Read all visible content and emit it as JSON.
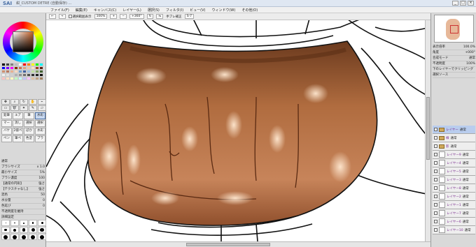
{
  "titlebar": {
    "app_name": "SAI",
    "file_name": "紺_CUSTOM DETRE (自動保存) ...",
    "minimize": "_",
    "maximize": "□",
    "close": "×"
  },
  "menubar": {
    "items": [
      "ファイル(F)",
      "編集(E)",
      "キャンバス(C)",
      "レイヤー(L)",
      "選択(S)",
      "フィルタ(I)",
      "ビュー(V)",
      "ウィンドウ(W)",
      "その他(O)"
    ]
  },
  "toolbar": {
    "selection_toggle": "選択範囲表示",
    "zoom": "100%",
    "angle": "+360°",
    "stabilizer_label": "手ブレ補正",
    "stabilizer_value": "S-7"
  },
  "left_panel": {
    "swatch_colors": [
      "#000000",
      "#404040",
      "#808080",
      "#c0c0c0",
      "#ffffff",
      "#ff0000",
      "#ff8000",
      "#ffff00",
      "#00ff00",
      "#00ffff",
      "#0000ff",
      "#8000ff",
      "#ff00ff",
      "#803000",
      "#c87050",
      "#e0a080",
      "#f0c8a8",
      "#ffe0c8",
      "#a04020",
      "#602010",
      "#d09070",
      "#b87860",
      "#e8b090",
      "#f8d8c0",
      "#70a0d0",
      "#4060a0",
      "#a0c0e0",
      "#c0e0a0",
      "#80a060",
      "#406030",
      "#f0f0f0",
      "#e0e0e0",
      "#d0d0d0",
      "#b0b0b0",
      "#909090",
      "#707070",
      "#505050",
      "#303030",
      "#202020",
      "#101010",
      "#ffc0c0",
      "#ffe0c0",
      "#ffffc0",
      "#c0ffc0",
      "#c0ffff",
      "#c0c0ff",
      "#ffc0ff",
      "#e0c0a0",
      "#c0a080",
      "#a08060"
    ],
    "tool_icons": [
      "move-icon",
      "zoom-icon",
      "rotate-icon",
      "hand-icon",
      "eyedropper-icon",
      "select-icon",
      "lasso-icon",
      "wand-icon",
      "pen-icon",
      "eraser-icon"
    ],
    "brushes": [
      "鉛筆",
      "エアブラシ",
      "筆",
      "水彩筆",
      "マーカー",
      "消しゴム",
      "選択ペン",
      "選択消し",
      "バケツ",
      "2値ペン",
      "ぼかし",
      "水彩",
      "ペン",
      "筆ペン",
      "色塗り",
      "ブラシ"
    ],
    "selected_brush_index": 3,
    "props": [
      {
        "label": "通常",
        "value": ""
      },
      {
        "label": "ブラシサイズ",
        "value": "x 1.0"
      },
      {
        "label": "最小サイズ",
        "value": "5%"
      },
      {
        "label": "ブラシ濃度",
        "value": "100"
      },
      {
        "label": "【通常の円形】",
        "value": "強さ"
      },
      {
        "label": "【テクスチャなし】",
        "value": "強さ"
      },
      {
        "label": "混色",
        "value": "50"
      },
      {
        "label": "水分量",
        "value": "0"
      },
      {
        "label": "色延び",
        "value": "0"
      },
      {
        "label": "不透明度を維持",
        "value": ""
      },
      {
        "label": "詳細設定",
        "value": ""
      }
    ],
    "size_labels": [
      "0.7",
      "0.8",
      "1",
      "1.5",
      "2",
      "2.3",
      "2.6",
      "3",
      "3.5",
      "4",
      "5",
      "6",
      "7",
      "8",
      "9"
    ]
  },
  "right_panel": {
    "props": [
      {
        "label": "表示倍率",
        "value": "100.0%"
      },
      {
        "label": "角度",
        "value": "+000°"
      },
      {
        "label": "合成モード",
        "value": "通常"
      },
      {
        "label": "不透明度",
        "value": "100%"
      },
      {
        "label": "下のレイヤーでクリッピング",
        "value": ""
      },
      {
        "label": "選択ソース",
        "value": ""
      }
    ],
    "layers": [
      {
        "name": "レイヤー",
        "mode": "通常",
        "type": "folder"
      },
      {
        "name": "線",
        "mode": "通常",
        "type": "folder"
      },
      {
        "name": "影",
        "mode": "通常",
        "type": "folder"
      },
      {
        "name": "レイヤー9",
        "mode": "通常",
        "type": "layer"
      },
      {
        "name": "レイヤー4",
        "mode": "通常",
        "type": "layer"
      },
      {
        "name": "レイヤー5",
        "mode": "通常",
        "type": "layer"
      },
      {
        "name": "レイヤー3",
        "mode": "通常",
        "type": "layer"
      },
      {
        "name": "レイヤー8",
        "mode": "通常",
        "type": "layer"
      },
      {
        "name": "レイヤー2",
        "mode": "通常",
        "type": "layer"
      },
      {
        "name": "レイヤー1",
        "mode": "通常",
        "type": "layer"
      },
      {
        "name": "レイヤー7",
        "mode": "通常",
        "type": "layer"
      },
      {
        "name": "レイヤー6",
        "mode": "通常",
        "type": "layer"
      },
      {
        "name": "レイヤー10",
        "mode": "通常",
        "type": "layer"
      }
    ],
    "selected_layer_index": 0
  }
}
